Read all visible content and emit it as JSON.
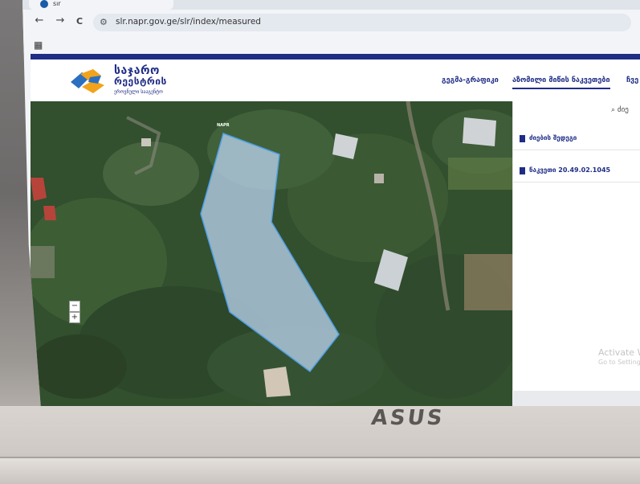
{
  "browser": {
    "tab_title": "sır",
    "url": "slr.napr.gov.ge/slr/index/measured",
    "nav_back": "←",
    "nav_forward": "→",
    "nav_reload": "C",
    "apps_icon": "apps-grid-icon"
  },
  "site": {
    "logo_line1": "საჯარო",
    "logo_line2": "რეესტრის",
    "logo_line3": "ეროვნული სააგენტო",
    "nav": [
      {
        "label": "გეგმა-გრაფიკი"
      },
      {
        "label": "აზომილი მიწის ნაკვეთები"
      },
      {
        "label": "ჩვე"
      }
    ]
  },
  "map": {
    "label": "NAPR",
    "zoom_out": "−",
    "zoom_in": "+"
  },
  "panel": {
    "search_label": "ძიე",
    "rows": [
      {
        "label": "ძიების შედეგი"
      },
      {
        "label": "ნაკვეთი 20.49.02.1045"
      }
    ],
    "watermark_title": "Activate W",
    "watermark_sub": "Go to Setting"
  },
  "device": {
    "brand": "ASUS"
  },
  "colors": {
    "brand_navy": "#1f2d86",
    "accent_orange": "#f2a21b",
    "parcel_fill": "#bcd6f2"
  }
}
